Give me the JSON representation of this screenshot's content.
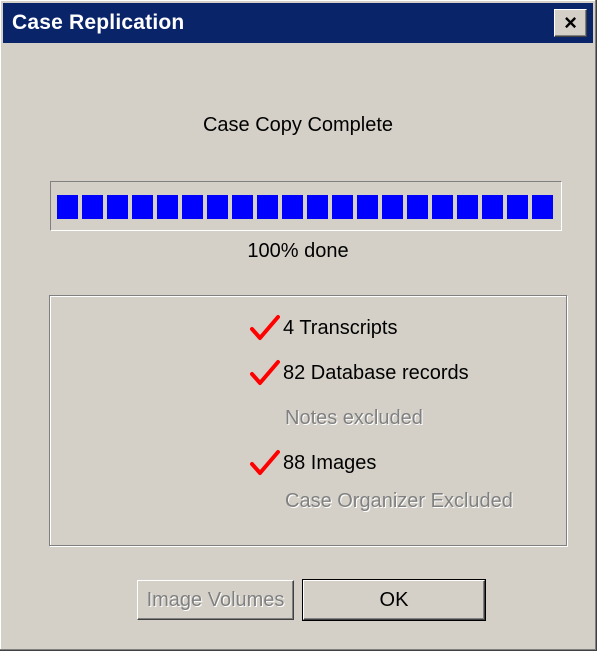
{
  "window": {
    "title": "Case Replication",
    "close_glyph": "×",
    "title_bar_color": "#0a246a"
  },
  "status_text": "Case Copy Complete",
  "progress": {
    "percent": 100,
    "label": "100% done",
    "fill_color": "#0000ff"
  },
  "summary": {
    "items": [
      {
        "label": "4 Transcripts",
        "checked": true,
        "icon": "checkmark-icon"
      },
      {
        "label": "82 Database records",
        "checked": true,
        "icon": "checkmark-icon"
      },
      {
        "label": "Notes excluded",
        "checked": false
      },
      {
        "label": "88 Images",
        "checked": true,
        "icon": "checkmark-icon"
      },
      {
        "label": "Case Organizer Excluded",
        "checked": false
      }
    ],
    "check_color": "#ff0000"
  },
  "buttons": {
    "image_volumes": "Image Volumes",
    "ok": "OK"
  }
}
